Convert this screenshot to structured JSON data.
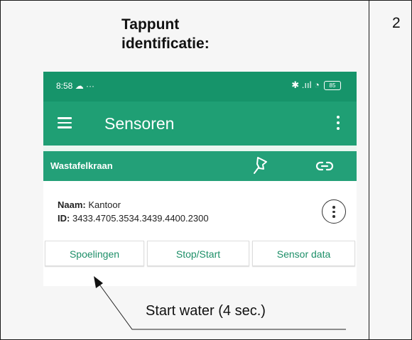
{
  "instruction": {
    "title_line1": "Tappunt",
    "title_line2": "identificatie:",
    "step_number": "2",
    "callout": "Start water (4 sec.)"
  },
  "status_bar": {
    "time": "8:58",
    "extra": "☁ ···",
    "icons": "✱ .ııl ◔",
    "battery": "85"
  },
  "app_bar": {
    "title": "Sensoren",
    "menu_icon": "hamburger-menu-icon",
    "more_icon": "more-vertical-icon"
  },
  "sensor": {
    "name": "Wastafelkraan",
    "pin_icon": "pin-icon",
    "link_icon": "link-icon",
    "naam_label": "Naam:",
    "naam_value": "Kantoor",
    "id_label": "ID:",
    "id_value": "3433.4705.3534.3439.4400.2300"
  },
  "actions": {
    "flush": "Spoelingen",
    "stop_start": "Stop/Start",
    "sensor_data": "Sensor data"
  },
  "colors": {
    "status_bar": "#16946a",
    "app_bar": "#1f9f74",
    "sensor_header": "#23a078",
    "button_text": "#1d8f68"
  }
}
